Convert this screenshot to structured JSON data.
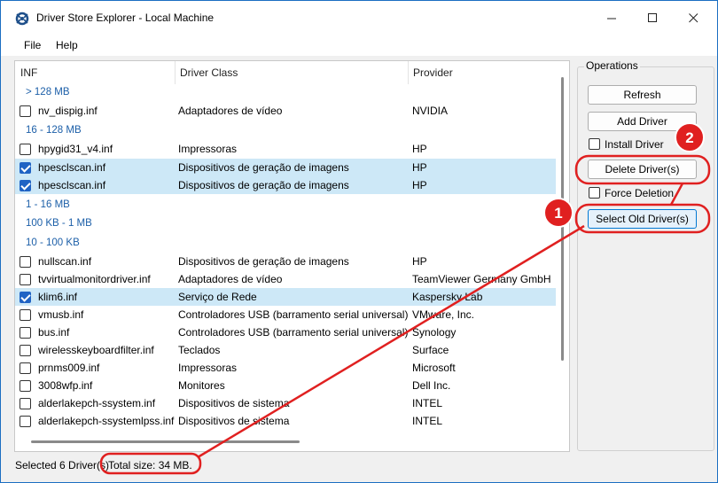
{
  "window": {
    "title": "Driver Store Explorer - Local Machine"
  },
  "menu": {
    "file": "File",
    "help": "Help"
  },
  "columns": {
    "inf": "INF",
    "driver_class": "Driver Class",
    "provider": "Provider"
  },
  "groups": {
    "g128": "> 128 MB",
    "g16_128": "16 - 128 MB",
    "g1_16": "1 - 16 MB",
    "g100k_1": "100 KB - 1 MB",
    "g10_100": "10 - 100 KB"
  },
  "rows": [
    {
      "inf": "nv_dispig.inf",
      "class": "Adaptadores de vídeo",
      "provider": "NVIDIA",
      "checked": false
    },
    {
      "inf": "hpygid31_v4.inf",
      "class": "Impressoras",
      "provider": "HP",
      "checked": false
    },
    {
      "inf": "hpesclscan.inf",
      "class": "Dispositivos de geração de imagens",
      "provider": "HP",
      "checked": true
    },
    {
      "inf": "hpesclscan.inf",
      "class": "Dispositivos de geração de imagens",
      "provider": "HP",
      "checked": true
    },
    {
      "inf": "nullscan.inf",
      "class": "Dispositivos de geração de imagens",
      "provider": "HP",
      "checked": false
    },
    {
      "inf": "tvvirtualmonitordriver.inf",
      "class": "Adaptadores de vídeo",
      "provider": "TeamViewer Germany GmbH",
      "checked": false
    },
    {
      "inf": "klim6.inf",
      "class": "Serviço de Rede",
      "provider": "Kaspersky Lab",
      "checked": true
    },
    {
      "inf": "vmusb.inf",
      "class": "Controladores USB (barramento serial universal)",
      "provider": "VMware, Inc.",
      "checked": false
    },
    {
      "inf": "bus.inf",
      "class": "Controladores USB (barramento serial universal)",
      "provider": "Synology",
      "checked": false
    },
    {
      "inf": "wirelesskeyboardfilter.inf",
      "class": "Teclados",
      "provider": "Surface",
      "checked": false
    },
    {
      "inf": "prnms009.inf",
      "class": "Impressoras",
      "provider": "Microsoft",
      "checked": false
    },
    {
      "inf": "3008wfp.inf",
      "class": "Monitores",
      "provider": "Dell Inc.",
      "checked": false
    },
    {
      "inf": "alderlakepch-ssystem.inf",
      "class": "Dispositivos de sistema",
      "provider": "INTEL",
      "checked": false
    },
    {
      "inf": "alderlakepch-ssystemlpss.inf",
      "class": "Dispositivos de sistema",
      "provider": "INTEL",
      "checked": false
    }
  ],
  "operations": {
    "legend": "Operations",
    "refresh": "Refresh",
    "add_driver": "Add Driver",
    "install_driver": "Install Driver",
    "delete_drivers": "Delete Driver(s)",
    "force_deletion": "Force Deletion",
    "select_old": "Select Old Driver(s)"
  },
  "status": {
    "selected": "Selected 6 Driver(s)",
    "total_size": "Total size: 34 MB."
  },
  "callouts": {
    "one": "1",
    "two": "2"
  },
  "colors": {
    "accent": "#0078d4",
    "selection": "#cde8f7",
    "group_text": "#1c5fa8",
    "callout": "#e02020"
  },
  "icons": {
    "app": "driver-store-icon",
    "minimize": "minimize-icon",
    "maximize": "maximize-icon",
    "close": "close-icon"
  }
}
